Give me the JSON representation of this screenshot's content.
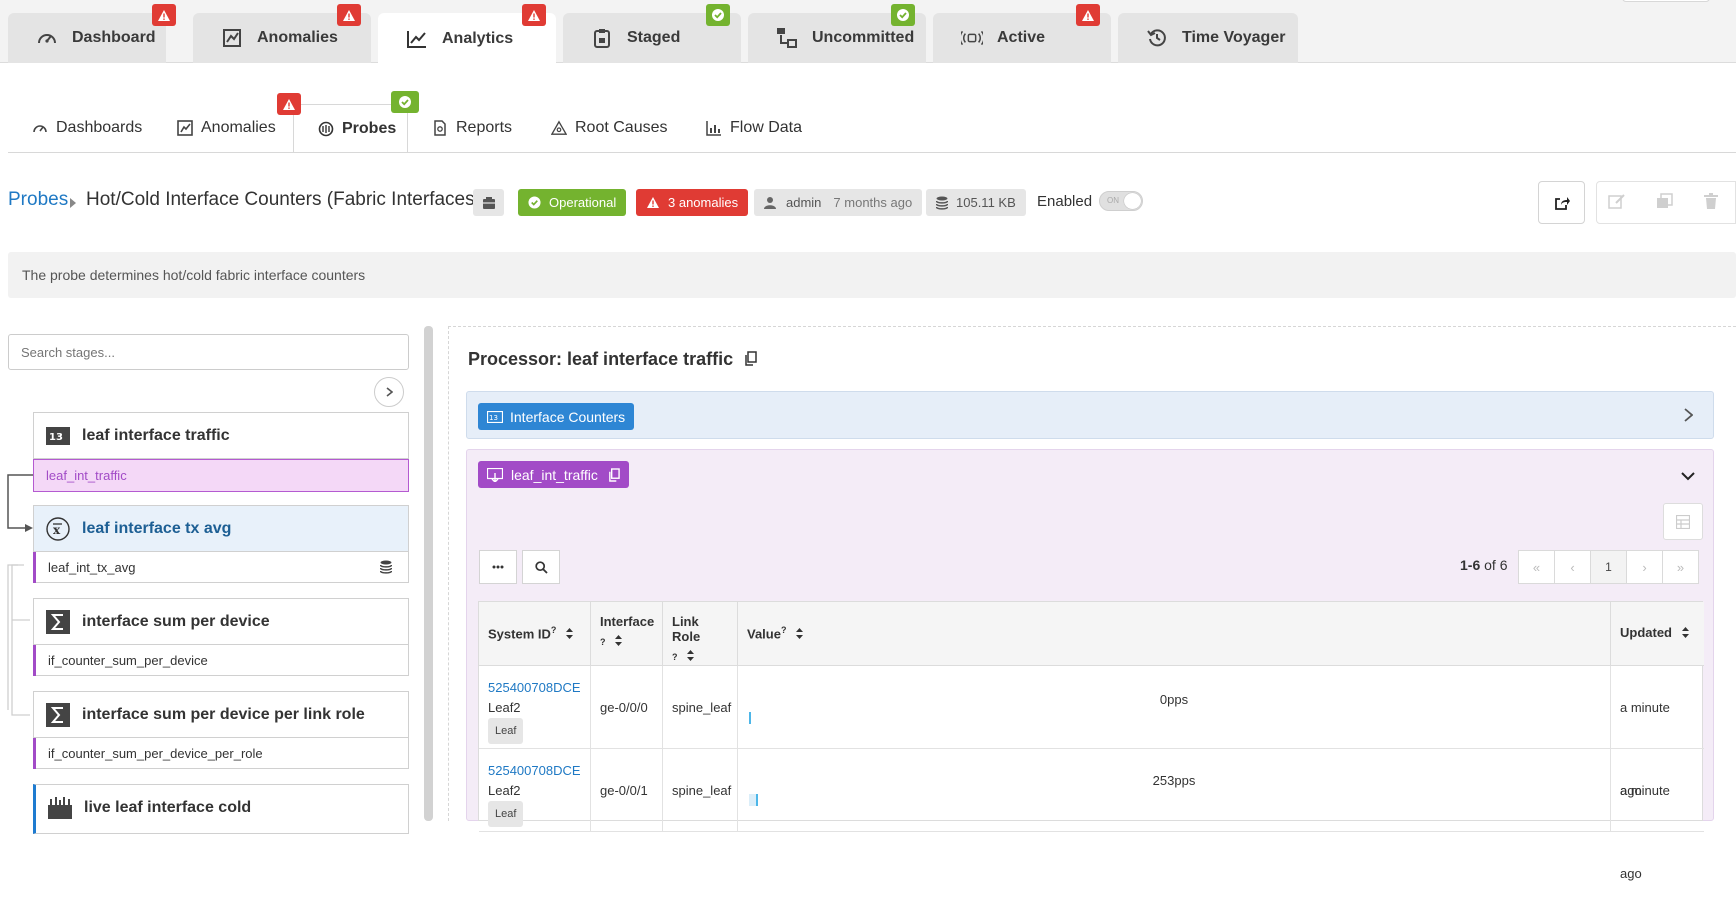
{
  "top_tabs": [
    {
      "label": "Dashboard",
      "badge": "warning"
    },
    {
      "label": "Anomalies",
      "badge": "warning"
    },
    {
      "label": "Analytics",
      "badge": "warning"
    },
    {
      "label": "Staged",
      "badge": "ok"
    },
    {
      "label": "Uncommitted",
      "badge": "ok"
    },
    {
      "label": "Active",
      "badge": "warning"
    },
    {
      "label": "Time Voyager",
      "badge": ""
    }
  ],
  "active_top_tab": "Analytics",
  "sub_tabs": [
    {
      "label": "Dashboards"
    },
    {
      "label": "Anomalies",
      "badge": "warning"
    },
    {
      "label": "Probes",
      "badge": "ok"
    },
    {
      "label": "Reports"
    },
    {
      "label": "Root Causes"
    },
    {
      "label": "Flow Data"
    }
  ],
  "active_sub_tab": "Probes",
  "header": {
    "breadcrumb": "Probes",
    "title": "Hot/Cold Interface Counters (Fabric Interfaces)",
    "status": "Operational",
    "anomalies": "3 anomalies",
    "user": "admin",
    "time": "7 months ago",
    "size": "105.11 KB",
    "enabled_label": "Enabled",
    "toggle_text": "ON"
  },
  "description": "The probe determines hot/cold fabric interface counters",
  "search": {
    "placeholder": "Search stages..."
  },
  "stages": [
    {
      "title": "leaf interface traffic",
      "output": "leaf_int_traffic",
      "icon": "counter-icon"
    },
    {
      "title": "leaf interface tx avg",
      "output": "leaf_int_tx_avg",
      "icon": "average-icon"
    },
    {
      "title": "interface sum per device",
      "output": "if_counter_sum_per_device",
      "icon": "sum-icon"
    },
    {
      "title": "interface sum per device per link role",
      "output": "if_counter_sum_per_device_per_role",
      "icon": "sum-icon"
    },
    {
      "title": "live leaf interface cold",
      "output": "",
      "icon": "range-icon"
    }
  ],
  "processor": {
    "title": "Processor: leaf interface traffic",
    "input_label": "Interface Counters",
    "output_label": "leaf_int_traffic"
  },
  "pagination": {
    "range": "1-6",
    "of": "of 6",
    "current": "1"
  },
  "table": {
    "columns": [
      "System ID",
      "Interface",
      "Link Role",
      "Value",
      "Updated"
    ],
    "rows": [
      {
        "system_id": "525400708DCE",
        "host": "Leaf2",
        "role_chip": "Leaf",
        "interface": "ge-0/0/0",
        "link_role": "spine_leaf",
        "value": "0pps",
        "bar": 0.0,
        "updated": "a minute ago"
      },
      {
        "system_id": "525400708DCE",
        "host": "Leaf2",
        "role_chip": "Leaf",
        "interface": "ge-0/0/1",
        "link_role": "spine_leaf",
        "value": "253pps",
        "bar": 0.01,
        "updated": "a minute ago"
      }
    ]
  },
  "colors": {
    "accent": "#1f79c4",
    "ok": "#74b32f",
    "danger": "#e03b34",
    "purple": "#a24bc7",
    "blue_btn": "#2e86d4"
  }
}
